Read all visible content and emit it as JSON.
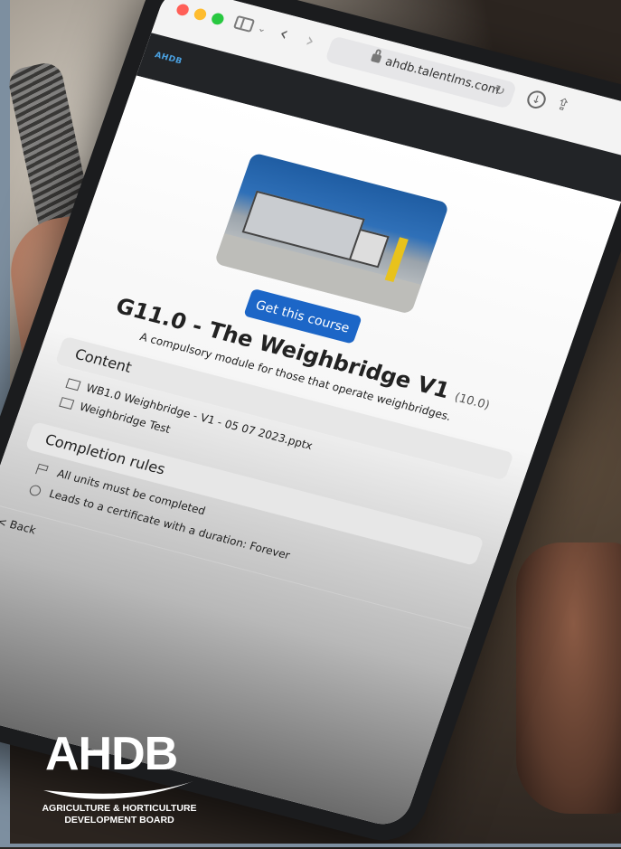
{
  "browser": {
    "url": "ahdb.talentlms.com",
    "icons": [
      "close-dot",
      "minimize-dot",
      "zoom-dot",
      "sidebar-icon",
      "back-icon",
      "forward-icon",
      "lock-icon",
      "reload-icon",
      "download-icon",
      "share-icon"
    ]
  },
  "site": {
    "logo_text": "AHDB"
  },
  "course": {
    "cta_label": "Get this course",
    "title": "G11.0 - The Weighbridge V1",
    "version": "(10.0)",
    "description": "A compulsory module for those that operate weighbridges."
  },
  "content_section": {
    "heading": "Content",
    "units": [
      {
        "icon": "presentation-icon",
        "label": "WB1.0 Weighbridge - V1 - 05 07 2023.pptx"
      },
      {
        "icon": "test-icon",
        "label": "Weighbridge Test"
      }
    ]
  },
  "completion_section": {
    "heading": "Completion rules",
    "rules": [
      {
        "icon": "flag-icon",
        "label": "All units must be completed"
      },
      {
        "icon": "certificate-icon",
        "label": "Leads to a certificate with a duration: Forever"
      }
    ]
  },
  "back_label": "< Back",
  "brand": {
    "wordmark": "AHDB",
    "tagline_line1": "AGRICULTURE & HORTICULTURE",
    "tagline_line2": "DEVELOPMENT BOARD"
  },
  "colors": {
    "accent": "#1c66c7",
    "strip": "#7d8fa0"
  }
}
